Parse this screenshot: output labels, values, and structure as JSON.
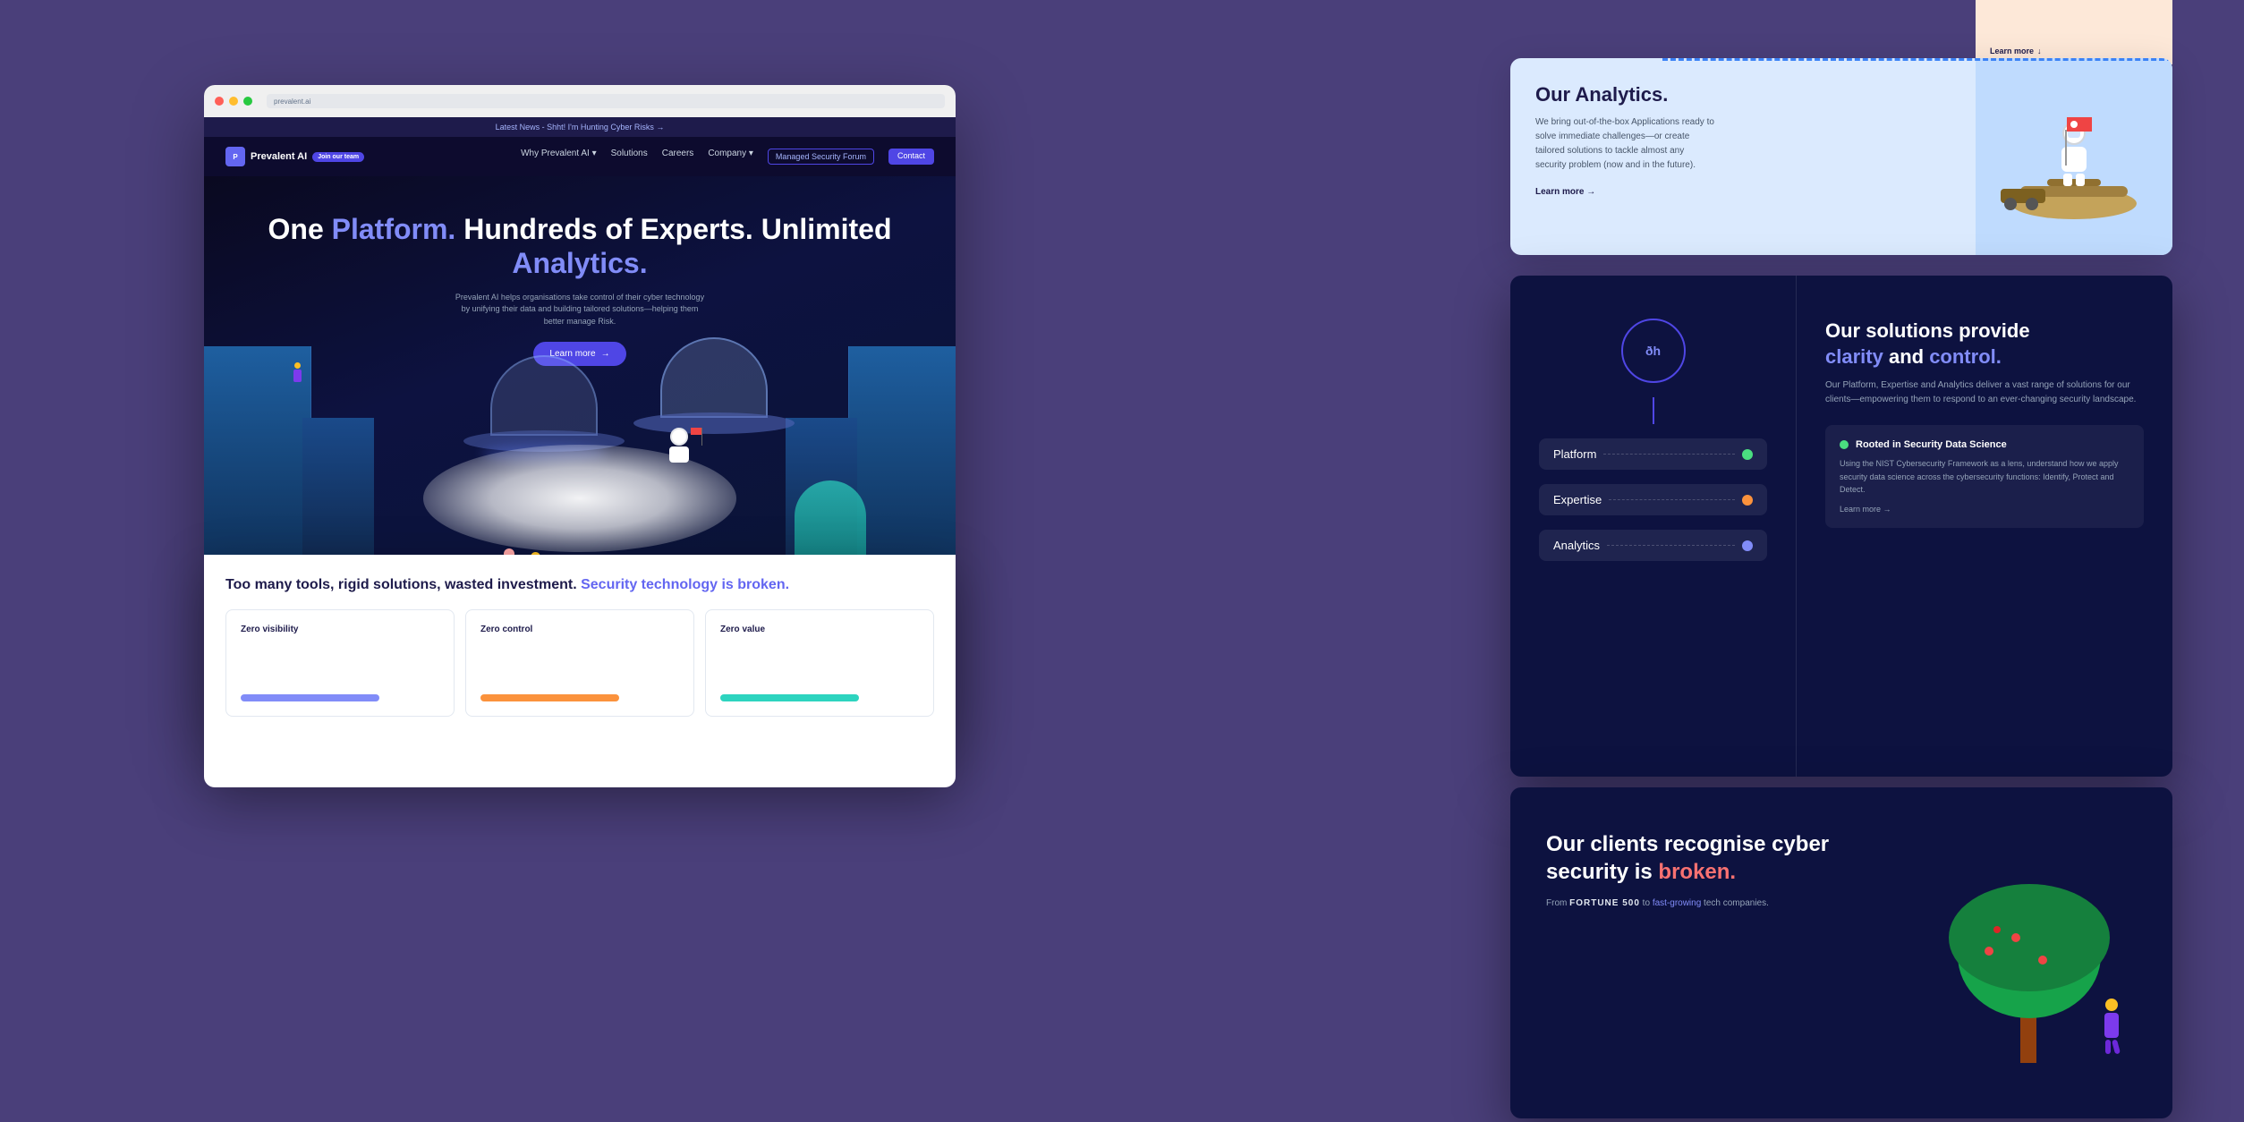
{
  "background": {
    "color": "#4a3f7a"
  },
  "announcement": {
    "text": "Latest News - Shht! I'm Hunting Cyber Risks →"
  },
  "navbar": {
    "logo": "Prevalent AI",
    "join_team": "Join our team",
    "links": [
      "Why Prevalent AI ▾",
      "Solutions",
      "Careers",
      "Company ▾"
    ],
    "managed_security": "Managed Security Forum",
    "contact": "Contact"
  },
  "hero": {
    "title_part1": "One ",
    "title_platform": "Platform.",
    "title_part2": " Hundreds of Experts. Unlimited ",
    "title_analytics": "Analytics.",
    "subtitle": "Prevalent AI helps organisations take control of their cyber technology by unifying their data and building tailored solutions—helping them better manage Risk.",
    "cta_label": "Learn more",
    "cta_arrow": "→"
  },
  "analytics_section": {
    "title": "Our Analytics.",
    "text": "We bring out-of-the-box Applications ready to solve immediate challenges—or create tailored solutions to tackle almost any security problem (now and in the future).",
    "learn_more": "Learn more →"
  },
  "solutions_section": {
    "title_part1": "Our solutions provide ",
    "clarity": "clarity",
    "title_and": " and ",
    "control": "control.",
    "text": "Our Platform, Expertise and Analytics deliver a vast range of solutions for our clients—empowering them to respond to an ever-changing security landscape.",
    "circle_icon": "ðh",
    "items": [
      {
        "label": "Platform",
        "dot_color": "green"
      },
      {
        "label": "Expertise",
        "dot_color": "orange"
      },
      {
        "label": "Analytics",
        "dot_color": "purple"
      }
    ],
    "rooted_card": {
      "title": "Rooted in Security Data Science",
      "text": "Using the NIST Cybersecurity Framework as a lens, understand how we apply security data science across the cybersecurity functions: Identify, Protect and Detect.",
      "learn_more": "Learn more →"
    }
  },
  "clients_section": {
    "title_part1": "Our clients recognise cyber security is ",
    "broken": "broken.",
    "subtitle_pre": "From ",
    "fortune500": "FORTUNE 500",
    "subtitle_mid": " to ",
    "fast_growing": "fast-growing",
    "subtitle_post": " tech companies."
  },
  "bottom_section": {
    "title_part1": "Too many tools, rigid solutions, wasted investment. ",
    "broken": "Security technology is broken.",
    "cards": [
      {
        "label": "Zero visibility",
        "color": "#818cf8"
      },
      {
        "label": "Zero control",
        "color": "#fb923c"
      },
      {
        "label": "Zero value",
        "color": "#2dd4bf"
      }
    ]
  }
}
